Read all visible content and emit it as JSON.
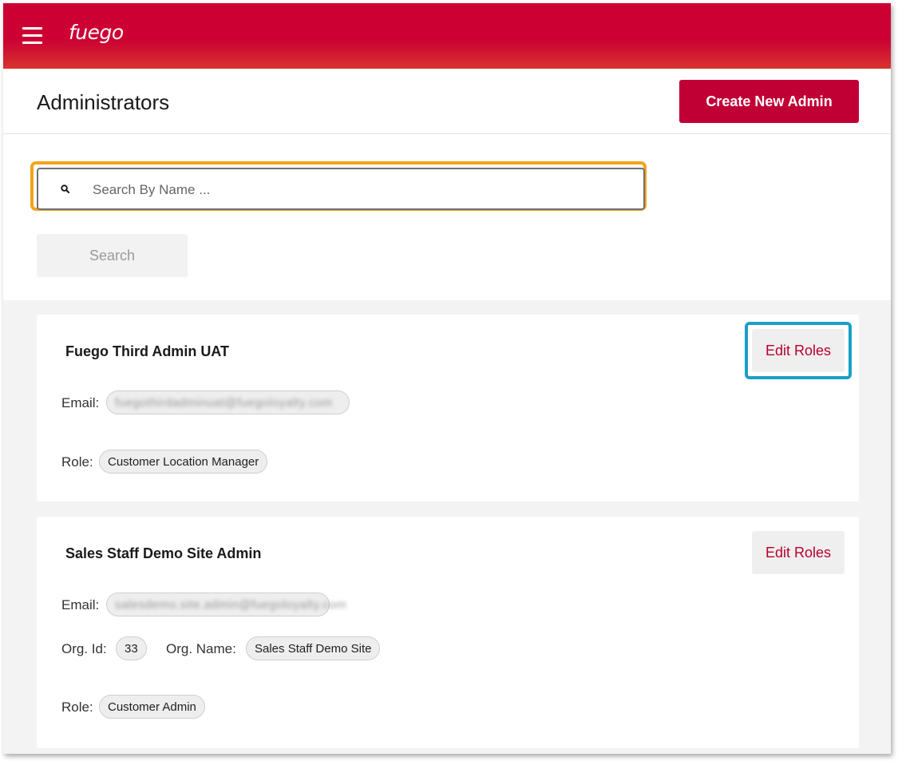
{
  "app": {
    "logo": "fuego"
  },
  "header": {
    "title": "Administrators",
    "create_label": "Create New Admin"
  },
  "search": {
    "placeholder": "Search By Name ...",
    "value": "",
    "button_label": "Search"
  },
  "colors": {
    "brand_red": "#cc0033",
    "button_red": "#c00035",
    "highlight_orange": "#f5a31a",
    "highlight_blue": "#1a9fc9"
  },
  "icons": {
    "menu": "hamburger-menu-icon",
    "search": "search-icon"
  },
  "labels": {
    "email": "Email:",
    "role": "Role:",
    "org_id": "Org. Id:",
    "org_name": "Org. Name:",
    "edit_roles": "Edit Roles"
  },
  "admins": [
    {
      "name": "Fuego Third Admin UAT",
      "email": "fuegothirdadminuat@fuegoloyalty.com",
      "role": "Customer Location Manager"
    },
    {
      "name": "Sales Staff Demo Site Admin",
      "email": "salesdemo.site.admin@fuegoloyalty.com",
      "org_id": "33",
      "org_name": "Sales Staff Demo Site",
      "role": "Customer Admin"
    }
  ]
}
